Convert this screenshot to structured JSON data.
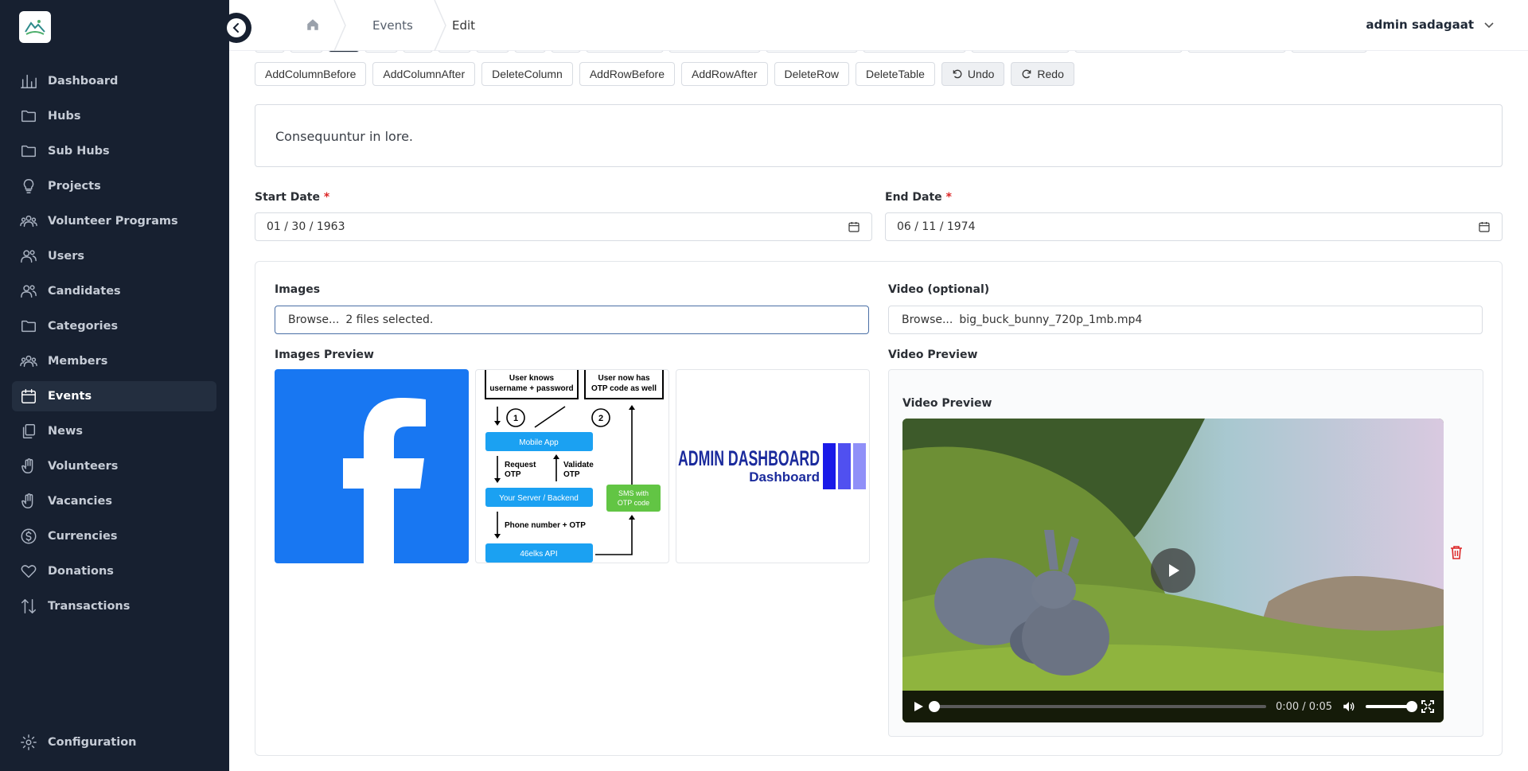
{
  "sidebar": {
    "items": [
      {
        "label": "Dashboard",
        "icon": "bar-chart-icon"
      },
      {
        "label": "Hubs",
        "icon": "folder-icon"
      },
      {
        "label": "Sub Hubs",
        "icon": "folder-icon"
      },
      {
        "label": "Projects",
        "icon": "lightbulb-icon"
      },
      {
        "label": "Volunteer Programs",
        "icon": "group-icon"
      },
      {
        "label": "Users",
        "icon": "users-icon"
      },
      {
        "label": "Candidates",
        "icon": "users-icon"
      },
      {
        "label": "Categories",
        "icon": "folder-icon"
      },
      {
        "label": "Members",
        "icon": "group-icon"
      },
      {
        "label": "Events",
        "icon": "calendar-icon",
        "active": true
      },
      {
        "label": "News",
        "icon": "copy-icon"
      },
      {
        "label": "Volunteers",
        "icon": "hand-icon"
      },
      {
        "label": "Vacancies",
        "icon": "hand-icon"
      },
      {
        "label": "Currencies",
        "icon": "dollar-icon"
      },
      {
        "label": "Donations",
        "icon": "heart-icon"
      },
      {
        "label": "Transactions",
        "icon": "arrows-icon"
      }
    ],
    "config_label": "Configuration"
  },
  "header": {
    "breadcrumbs": [
      "Events",
      "Edit"
    ],
    "user_name": "admin sadagaat"
  },
  "toolbar": {
    "buttons": [
      "AddColumnBefore",
      "AddColumnAfter",
      "DeleteColumn",
      "AddRowBefore",
      "AddRowAfter",
      "DeleteRow",
      "DeleteTable"
    ],
    "undo_label": "Undo",
    "redo_label": "Redo"
  },
  "editor": {
    "content": "Consequuntur in lore."
  },
  "dates": {
    "start_label": "Start Date",
    "start_value": "01 / 30 / 1963",
    "end_label": "End Date",
    "end_value": "06 / 11 / 1974",
    "required_mark": "*"
  },
  "media": {
    "images_label": "Images",
    "images_browse": "Browse...",
    "images_status": "2 files selected.",
    "video_label": "Video (optional)",
    "video_browse": "Browse...",
    "video_file": "big_buck_bunny_720p_1mb.mp4",
    "images_preview_label": "Images Preview",
    "video_preview_label": "Video Preview",
    "video_preview_inner_label": "Video Preview",
    "video_time": "0:00 / 0:05",
    "video_progress": 0.0,
    "volume_level": 1.0
  },
  "thumbnails": {
    "diagram": {
      "box1": "User knows username + password",
      "box2": "User now has OTP code as well",
      "step1": "1",
      "step2": "2",
      "mobile": "Mobile App",
      "request": "Request OTP",
      "validate": "Validate OTP",
      "server": "Your Server / Backend",
      "sms": "SMS with OTP code",
      "phone": "Phone number + OTP",
      "api": "46elks API"
    },
    "banner_line1": "ADMIN DASHBOARD",
    "banner_line2": "Dashboard"
  },
  "colors": {
    "sidebar_bg": "#172030",
    "accent_blue": "#1a73e8",
    "danger": "#dc2626",
    "facebook_blue": "#1877f2",
    "sms_green": "#62c544",
    "diagram_blue": "#1ba1f2"
  }
}
